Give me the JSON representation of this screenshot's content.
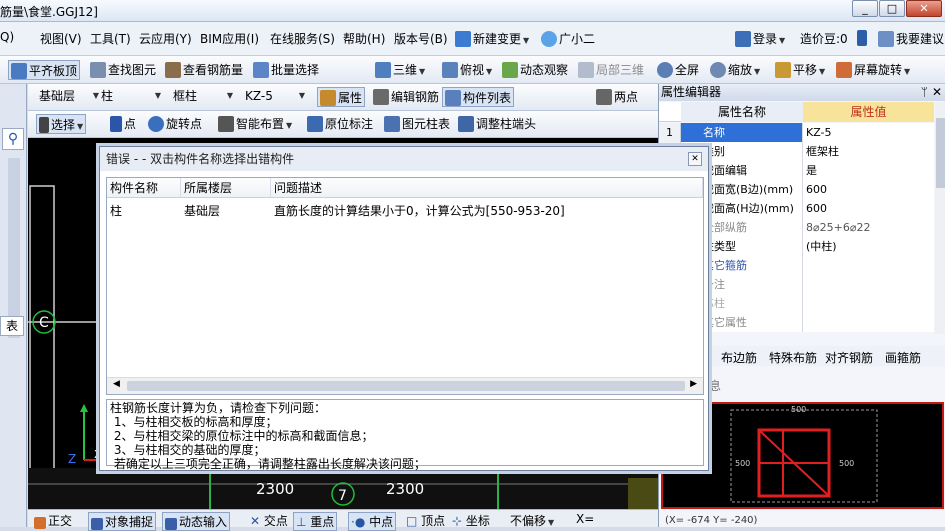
{
  "window": {
    "title": "筋量\\食堂.GGJ12]",
    "min": "_",
    "max": "□",
    "close": "✕"
  },
  "menus": [
    "Q)",
    "视图(V)",
    "工具(T)",
    "云应用(Y)",
    "BIM应用(I)",
    "在线服务(S)",
    "帮助(H)",
    "版本号(B)",
    "新建变更",
    "广小二",
    "登录",
    "造价豆:0",
    "我要建议"
  ],
  "toolbar1": [
    "平齐板顶",
    "查找图元",
    "查看钢筋量",
    "批量选择",
    "三维",
    "俯视",
    "动态观察",
    "局部三维",
    "全屏",
    "缩放",
    "平移",
    "屏幕旋转"
  ],
  "toolbar2": {
    "floor": "基础层",
    "type": "柱",
    "subtype": "框柱",
    "component": "KZ-5",
    "buttons": [
      "属性",
      "编辑钢筋",
      "构件列表",
      "两点"
    ]
  },
  "toolbar3": [
    "选择",
    "点",
    "旋转点",
    "智能布置",
    "原位标注",
    "图元柱表",
    "调整柱端头"
  ],
  "left_tabs": [
    "表"
  ],
  "canvas": {
    "labels": [
      "C",
      "2300",
      "7",
      "2300",
      "Z",
      "X"
    ]
  },
  "properties": {
    "title": "属性编辑器",
    "header_name": "属性名称",
    "header_value": "属性值",
    "rows": [
      {
        "num": "1",
        "name": "名称",
        "value": "KZ-5"
      },
      {
        "num": "",
        "name": "类别",
        "value": "框架柱"
      },
      {
        "num": "",
        "name": "截面编辑",
        "value": "是"
      },
      {
        "num": "",
        "name": "截面宽(B边)(mm)",
        "value": "600"
      },
      {
        "num": "",
        "name": "截面高(H边)(mm)",
        "value": "600"
      },
      {
        "num": "",
        "name": "全部纵筋",
        "value": "8⌀25+6⌀22"
      },
      {
        "num": "",
        "name": "柱类型",
        "value": "(中柱)"
      },
      {
        "num": "",
        "name": "其它箍筋",
        "value": ""
      },
      {
        "num": "",
        "name": "备注",
        "value": ""
      },
      {
        "num": "",
        "name": "芯柱",
        "value": ""
      },
      {
        "num": "",
        "name": "其它属性",
        "value": ""
      }
    ],
    "sub_tabs": [
      "布边筋",
      "特殊布筋",
      "对齐钢筋",
      "画箍筋"
    ],
    "sub_label": "息",
    "section_labels": [
      "500",
      "500",
      "500"
    ]
  },
  "dialog": {
    "title": "错误 - - 双击构件名称选择出错构件",
    "close": "✕",
    "columns": [
      "构件名称",
      "所属楼层",
      "问题描述"
    ],
    "rows": [
      {
        "name": "柱",
        "floor": "基础层",
        "desc": "直筋长度的计算结果小于0，计算公式为[550-953-20]"
      }
    ],
    "message": "柱钢筋长度计算为负，请检查下列问题：\n 1、与柱相交板的标高和厚度；\n 2、与柱相交梁的原位标注中的标高和截面信息；\n 3、与柱相交的基础的厚度；\n 若确定以上三项完全正确，请调整柱露出长度解决该问题；"
  },
  "statusbar": [
    "正交",
    "对象捕捉",
    "动态输入",
    "交点",
    "重点",
    "中点",
    "顶点",
    "坐标",
    "不偏移",
    "X="
  ],
  "bottom_right": "(X= -674 Y= -240)"
}
